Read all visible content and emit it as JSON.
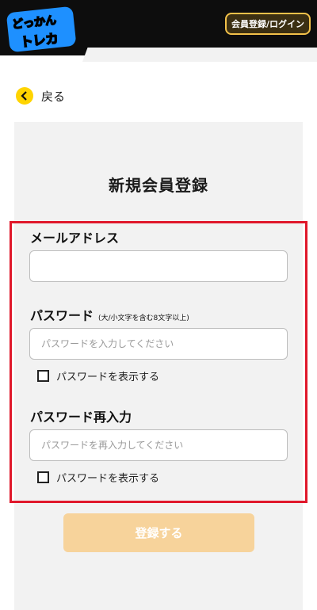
{
  "header": {
    "logo_text_top": "どっかん",
    "logo_text_bottom": "トレカ",
    "login_button": "会員登録/ログイン"
  },
  "back": {
    "label": "戻る"
  },
  "form": {
    "title": "新規会員登録",
    "email": {
      "label": "メールアドレス",
      "value": "",
      "placeholder": ""
    },
    "password": {
      "label": "パスワード",
      "hint": "(大/小文字を含む8文字以上)",
      "placeholder": "パスワードを入力してください",
      "show_label": "パスワードを表示する"
    },
    "password_confirm": {
      "label": "パスワード再入力",
      "placeholder": "パスワードを再入力してください",
      "show_label": "パスワードを表示する"
    },
    "submit_label": "登録する"
  },
  "colors": {
    "accent_yellow": "#ffd400",
    "highlight_red": "#e0182b",
    "submit_disabled": "#f7d39b",
    "card_bg": "#f2f2f2"
  }
}
